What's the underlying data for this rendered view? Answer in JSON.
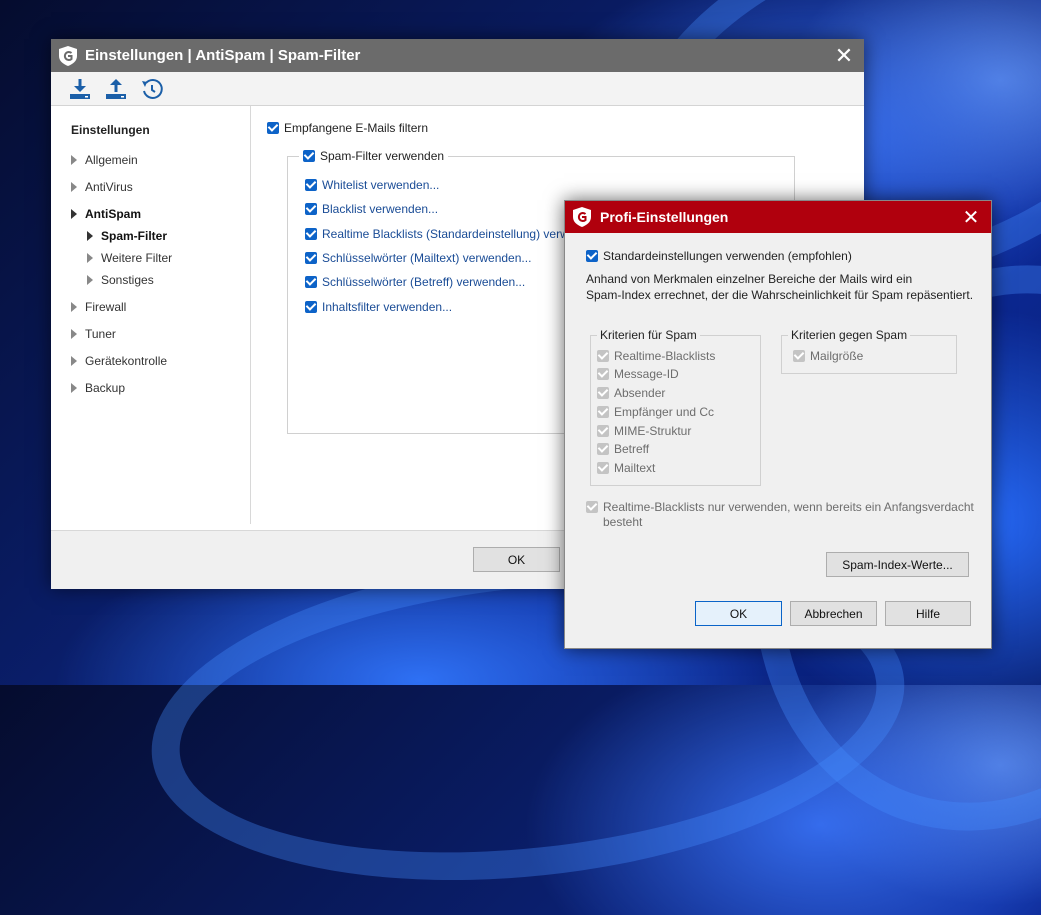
{
  "main": {
    "title": "Einstellungen | AntiSpam | Spam-Filter",
    "toolbar": [
      "import-icon",
      "export-icon",
      "restore-icon"
    ],
    "sidebar": {
      "heading": "Einstellungen",
      "items": [
        {
          "label": "Allgemein"
        },
        {
          "label": "AntiVirus"
        },
        {
          "label": "AntiSpam"
        },
        {
          "label": "Spam-Filter"
        },
        {
          "label": "Weitere Filter"
        },
        {
          "label": "Sonstiges"
        },
        {
          "label": "Firewall"
        },
        {
          "label": "Tuner"
        },
        {
          "label": "Gerätekontrolle"
        },
        {
          "label": "Backup"
        }
      ]
    },
    "content": {
      "filter_incoming": "Empfangene E-Mails filtern",
      "spam_filter": "Spam-Filter verwenden",
      "options": [
        {
          "label": "Whitelist verwenden..."
        },
        {
          "label": "Blacklist verwenden..."
        },
        {
          "label": "Realtime Blacklists (Standardeinstellung) verwenden..."
        },
        {
          "label": "Schlüsselwörter (Mailtext) verwenden..."
        },
        {
          "label": "Schlüsselwörter (Betreff) verwenden..."
        },
        {
          "label": "Inhaltsfilter verwenden..."
        }
      ]
    },
    "footer": {
      "ok": "OK"
    }
  },
  "dialog": {
    "title": "Profi-Einstellungen",
    "use_defaults": "Standardeinstellungen verwenden (empfohlen)",
    "description_1": "Anhand von Merkmalen einzelner Bereiche der Mails wird ein",
    "description_2": "Spam-Index errechnet, der die Wahrscheinlichkeit für Spam repäsentiert.",
    "criteria_for": {
      "label": "Kriterien für Spam",
      "items": [
        "Realtime-Blacklists",
        "Message-ID",
        "Absender",
        "Empfänger und Cc",
        "MIME-Struktur",
        "Betreff",
        "Mailtext"
      ]
    },
    "criteria_against": {
      "label": "Kriterien gegen Spam",
      "items": [
        "Mailgröße"
      ]
    },
    "realtime_1": "Realtime-Blacklists nur verwenden, wenn bereits ein Anfangsverdacht",
    "realtime_2": "besteht",
    "spam_index_button": "Spam-Index-Werte...",
    "ok": "OK",
    "cancel": "Abbrechen",
    "help": "Hilfe"
  },
  "colors": {
    "dialog_title": "#b0000d",
    "main_title": "#6b6b6b",
    "checkbox": "#0d63c8"
  }
}
